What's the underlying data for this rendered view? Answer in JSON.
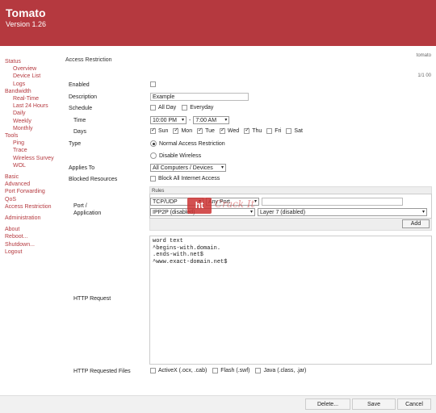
{
  "header": {
    "title": "Tomato",
    "version": "Version 1.26"
  },
  "sub_link": "tomato",
  "nav": [
    {
      "label": "Status",
      "level": 0
    },
    {
      "label": "Overview",
      "level": 1
    },
    {
      "label": "Device List",
      "level": 1
    },
    {
      "label": "Logs",
      "level": 1
    },
    {
      "label": "Bandwidth",
      "level": 0
    },
    {
      "label": "Real-Time",
      "level": 1
    },
    {
      "label": "Last 24 Hours",
      "level": 1
    },
    {
      "label": "Daily",
      "level": 1
    },
    {
      "label": "Weekly",
      "level": 1
    },
    {
      "label": "Monthly",
      "level": 1
    },
    {
      "label": "Tools",
      "level": 0
    },
    {
      "label": "Ping",
      "level": 1
    },
    {
      "label": "Trace",
      "level": 1
    },
    {
      "label": "Wireless Survey",
      "level": 1
    },
    {
      "label": "WOL",
      "level": 1
    },
    {
      "label": "Basic",
      "level": 0,
      "gap": true
    },
    {
      "label": "Advanced",
      "level": 0
    },
    {
      "label": "Port Forwarding",
      "level": 0
    },
    {
      "label": "QoS",
      "level": 0
    },
    {
      "label": "Access Restriction",
      "level": 0
    },
    {
      "label": "Administration",
      "level": 0,
      "gap": true
    },
    {
      "label": "About",
      "level": 0,
      "gap": true
    },
    {
      "label": "Reboot...",
      "level": 0
    },
    {
      "label": "Shutdown...",
      "level": 0
    },
    {
      "label": "Logout",
      "level": 0
    }
  ],
  "page": {
    "title": "Access Restriction",
    "page_num": "1/1 00"
  },
  "labels": {
    "enabled": "Enabled",
    "description": "Description",
    "schedule": "Schedule",
    "time": "Time",
    "days": "Days",
    "type": "Type",
    "applies_to": "Applies To",
    "blocked": "Blocked Resources",
    "port": "Port /",
    "application": "Application",
    "http_request": "HTTP Request",
    "http_files": "HTTP Requested Files"
  },
  "form": {
    "description": "Example",
    "all_day": "All Day",
    "everyday": "Everyday",
    "time_from": "10:00 PM",
    "time_sep": "-",
    "time_to": "7:00 AM",
    "days": [
      {
        "l": "Sun",
        "on": true
      },
      {
        "l": "Mon",
        "on": true
      },
      {
        "l": "Tue",
        "on": true
      },
      {
        "l": "Wed",
        "on": true
      },
      {
        "l": "Thu",
        "on": true
      },
      {
        "l": "Fri",
        "on": false
      },
      {
        "l": "Sat",
        "on": false
      }
    ],
    "type_normal": "Normal Access Restriction",
    "type_disable": "Disable Wireless",
    "applies": "All Computers / Devices",
    "block_all": "Block All Internet Access",
    "rules_header": "Rules",
    "proto": "TCP/UDP",
    "port_sel": "Any Port",
    "ipp2p": "IPP2P (disabled)",
    "layer7": "Layer 7 (disabled)",
    "add": "Add",
    "http_lines": [
      "word text",
      "^begins-with.domain.",
      ".ends-with.net$",
      "^www.exact-domain.net$"
    ],
    "files": {
      "activex": "ActiveX (.ocx, .cab)",
      "flash": "Flash (.swf)",
      "java": "Java (.class, .jar)"
    }
  },
  "watermark": {
    "logo": "ht",
    "text": "Crack It"
  },
  "buttons": {
    "delete": "Delete...",
    "save": "Save",
    "cancel": "Cancel"
  }
}
